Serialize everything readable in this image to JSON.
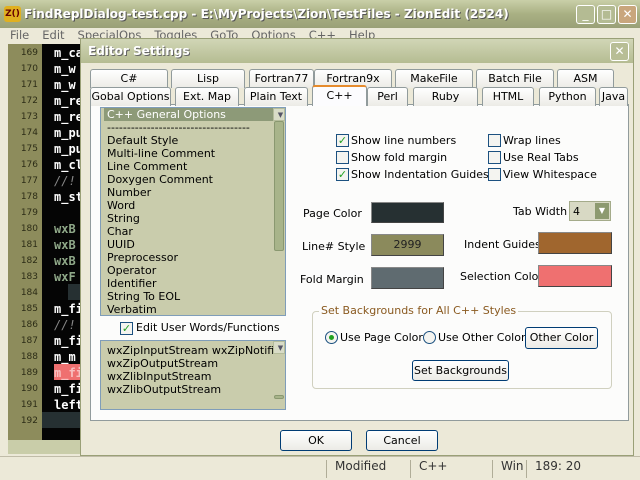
{
  "app": {
    "icon_text": "Z()",
    "title": "FindReplDialog-test.cpp - E:\\MyProjects\\Zion\\TestFiles - ZionEdit  (2524)",
    "menu": [
      "File",
      "Edit",
      "SpecialOps",
      "Toggles",
      "GoTo",
      "Options",
      "C++",
      "Help"
    ]
  },
  "editor": {
    "line_numbers": [
      "169",
      "170",
      "171",
      "172",
      "173",
      "174",
      "175",
      "176",
      "177",
      "178",
      "179",
      "180",
      "181",
      "182",
      "183",
      "184",
      "185",
      "186",
      "187",
      "188",
      "189",
      "190",
      "191",
      "192"
    ],
    "code": [
      "m_ca",
      "m_w",
      "m_w",
      "m_re",
      "m_re",
      "m_pu",
      "m_pu",
      "m_cl",
      "//! D",
      "m_st",
      "",
      "wxB",
      "wxB",
      "wxB",
      "wxF",
      "",
      "m_fi",
      "//! If",
      "m_fi",
      "m_m",
      "m_fi",
      "m_fi",
      "leftS",
      ""
    ]
  },
  "statusbar": {
    "items": [
      "Modified",
      "C++",
      "Win",
      "189: 20"
    ]
  },
  "dialog": {
    "title": "Editor Settings",
    "tabs_row1": [
      "C#",
      "Lisp",
      "Fortran77",
      "Fortran9x",
      "MakeFile",
      "Batch File",
      "ASM"
    ],
    "tabs_row2": [
      "Gobal Options",
      "Ext. Map",
      "Plain Text",
      "C++",
      "Perl",
      "Ruby",
      "HTML",
      "Python",
      "Java"
    ],
    "active_tab": "C++",
    "style_list": [
      "C++ General Options",
      "------------------------------------",
      "Default Style",
      "Multi-line Comment",
      "Line Comment",
      "Doxygen Comment",
      "Number",
      "Word",
      "String",
      "Char",
      "UUID",
      "Preprocessor",
      "Operator",
      "Identifier",
      "String To EOL",
      "Verbatim"
    ],
    "edit_user_words": {
      "label": "Edit User Words/Functions",
      "checked": true
    },
    "user_words": [
      "wxZipInputStream wxZipNotifier",
      "wxZipOutputStream",
      "wxZlibInputStream",
      "wxZlibOutputStream"
    ],
    "checkboxes": [
      {
        "label": "Show line numbers",
        "checked": true
      },
      {
        "label": "Show fold margin",
        "checked": false
      },
      {
        "label": "Show Indentation Guides",
        "checked": true
      },
      {
        "label": "Wrap lines",
        "checked": false
      },
      {
        "label": "Use Real Tabs",
        "checked": false
      },
      {
        "label": "View Whitespace",
        "checked": false
      }
    ],
    "page_color": {
      "label": "Page Color",
      "color": "#263032"
    },
    "line_style": {
      "label": "Line# Style",
      "sample": "2999",
      "color": "#8b8a5c"
    },
    "fold_margin": {
      "label": "Fold Margin",
      "color": "#5f6b70"
    },
    "tab_width": {
      "label": "Tab Width",
      "value": "4"
    },
    "indent_guides": {
      "label": "Indent Guides",
      "color": "#a0662e"
    },
    "selection_color": {
      "label": "Selection Color",
      "color": "#ef7070"
    },
    "backgrounds": {
      "title": "Set Backgrounds for All C++ Styles",
      "use_page": "Use Page Color",
      "use_other": "Use Other Color",
      "selected": "Use Page Color",
      "other_color_button": "Other Color",
      "set_button": "Set Backgrounds"
    },
    "ok": "OK",
    "cancel": "Cancel"
  }
}
